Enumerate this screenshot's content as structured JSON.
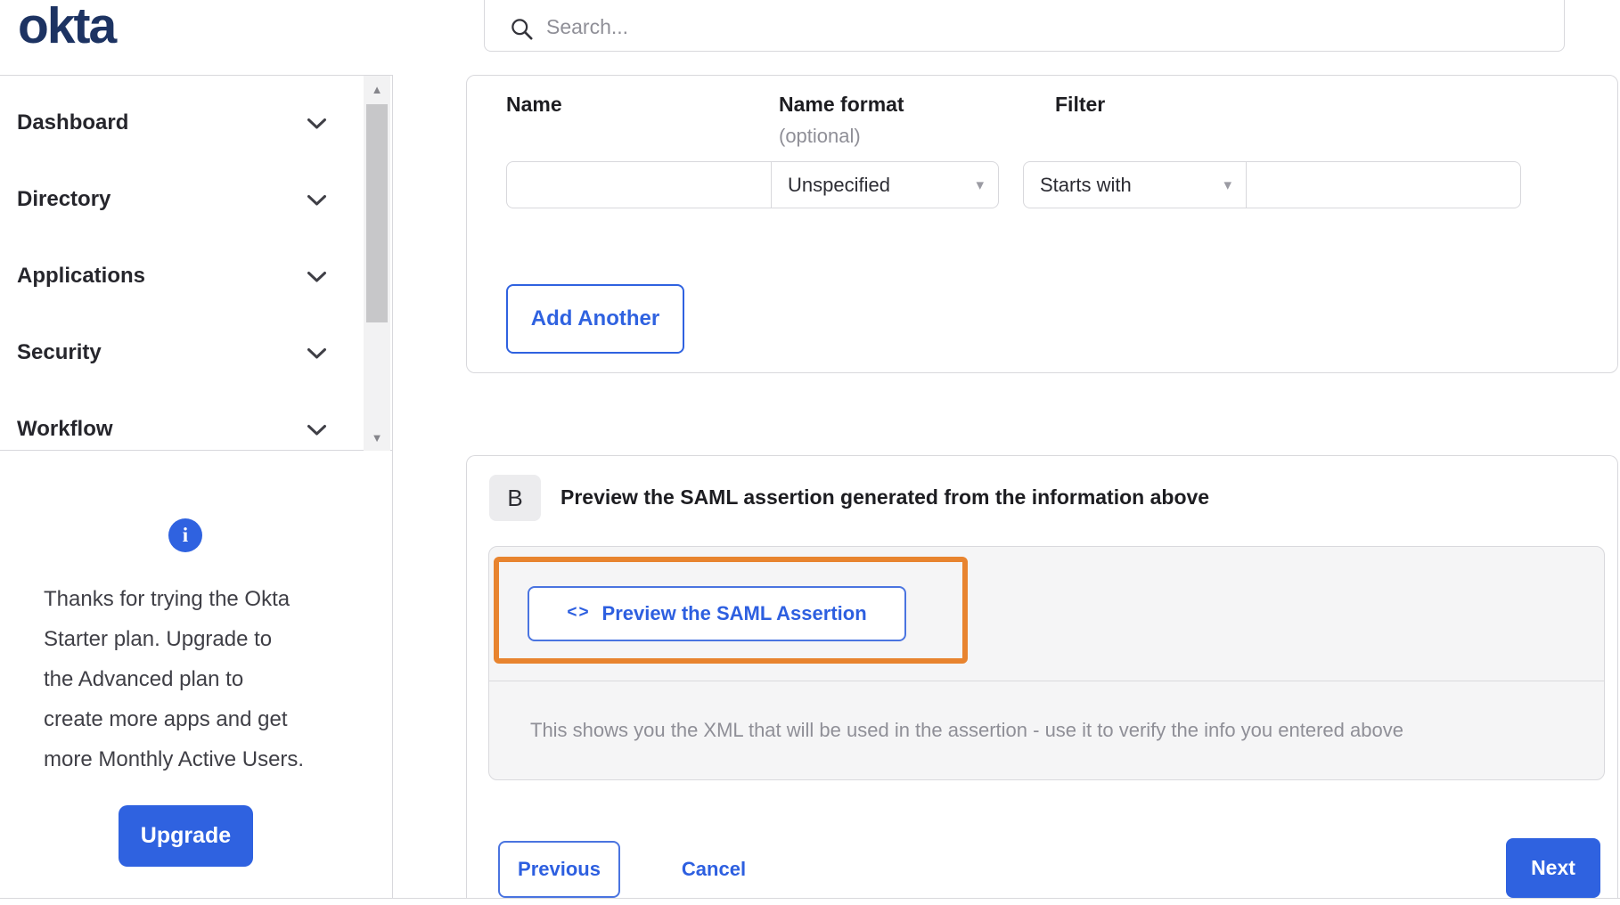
{
  "brand": {
    "logo_text": "okta"
  },
  "header": {
    "search_placeholder": "Search..."
  },
  "sidebar": {
    "items": [
      "Dashboard",
      "Directory",
      "Applications",
      "Security",
      "Workflow"
    ],
    "upsell": {
      "lines": [
        "Thanks for trying the Okta",
        "Starter plan. Upgrade to",
        "the Advanced plan to",
        "create more apps and get",
        "more Monthly Active Users."
      ],
      "button_label": "Upgrade",
      "info_glyph": "i"
    }
  },
  "attribute_form": {
    "name_label": "Name",
    "name_format_label": "Name format",
    "name_format_sublabel": "(optional)",
    "filter_label": "Filter",
    "name_value": "",
    "name_format_selected": "Unspecified",
    "filter_operator_selected": "Starts with",
    "filter_value": "",
    "add_another_label": "Add Another",
    "caret_glyph": "▾"
  },
  "preview_section": {
    "badge": "B",
    "title": "Preview the SAML assertion generated from the information above",
    "code_glyph": "<>",
    "preview_button_label": "Preview the SAML Assertion",
    "description": "This shows you the XML that will be used in the assertion - use it to verify the info you entered above"
  },
  "wizard_nav": {
    "previous_label": "Previous",
    "cancel_label": "Cancel",
    "next_label": "Next"
  },
  "scrollbar": {
    "up_glyph": "▲",
    "down_glyph": "▼"
  },
  "colors": {
    "accent_blue": "#2f62e0",
    "logo_navy": "#1d3362",
    "highlight_orange": "#e8842f",
    "border_gray": "#d8d8dc",
    "panel_gray": "#f5f5f6",
    "muted_text": "#8f8f97"
  }
}
